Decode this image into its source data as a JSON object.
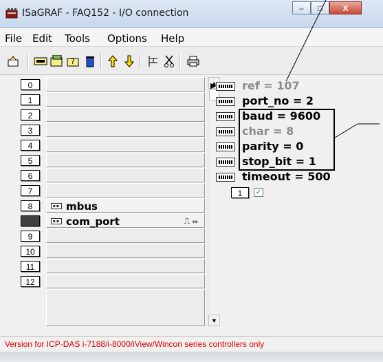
{
  "window": {
    "title": "ISaGRAF - FAQ152 - I/O connection",
    "minimize": "–",
    "maximize": "□",
    "close": "X"
  },
  "menu": [
    "File",
    "Edit",
    "Tools",
    "Options",
    "Help"
  ],
  "toolbar": {
    "icons": [
      "open-icon",
      "board-icon",
      "edit-icon",
      "calibrate-icon",
      "delete-icon",
      "up-arrow-icon",
      "down-arrow-icon",
      "tree-icon",
      "cut-icon",
      "print-icon"
    ]
  },
  "slots": [
    {
      "num": "0",
      "label": ""
    },
    {
      "num": "1",
      "label": ""
    },
    {
      "num": "2",
      "label": ""
    },
    {
      "num": "3",
      "label": ""
    },
    {
      "num": "4",
      "label": ""
    },
    {
      "num": "5",
      "label": ""
    },
    {
      "num": "6",
      "label": ""
    },
    {
      "num": "7",
      "label": ""
    },
    {
      "num": "8",
      "label": "mbus"
    },
    {
      "num": "",
      "label": "com_port",
      "extra": "⎍ ⬰"
    },
    {
      "num": "9",
      "label": ""
    },
    {
      "num": "10",
      "label": ""
    },
    {
      "num": "11",
      "label": ""
    },
    {
      "num": "12",
      "label": ""
    }
  ],
  "params": [
    {
      "text": "ref = 107",
      "gray": true
    },
    {
      "text": "port_no = 2",
      "gray": false
    },
    {
      "text": "baud = 9600",
      "gray": false
    },
    {
      "text": "char = 8",
      "gray": true
    },
    {
      "text": "parity = 0",
      "gray": false
    },
    {
      "text": "stop_bit = 1",
      "gray": false
    },
    {
      "text": "timeout = 500",
      "gray": false
    }
  ],
  "channel": {
    "num": "1",
    "check": "✓"
  },
  "status": "Version for ICP-DAS i-7188/i-8000/iView/Wincon series controllers only"
}
